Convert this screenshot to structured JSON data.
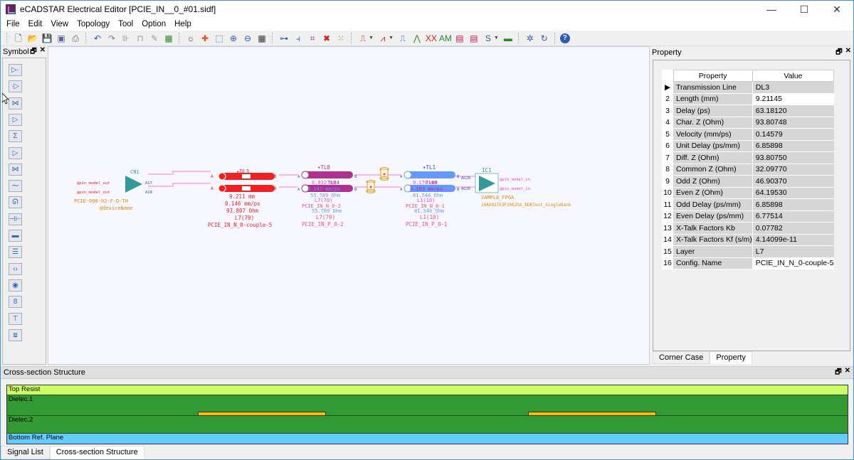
{
  "window": {
    "title": "eCADSTAR Electrical Editor [PCIE_IN__0_#01.sidf]",
    "controls": {
      "minimize": "—",
      "maximize": "☐",
      "close": "✕"
    }
  },
  "menu": [
    "File",
    "Edit",
    "View",
    "Topology",
    "Tool",
    "Option",
    "Help"
  ],
  "toolbar": {
    "groups": [
      [
        {
          "name": "new-file-icon",
          "glyph": "🗋",
          "color": "#444"
        },
        {
          "name": "open-folder-icon",
          "glyph": "📂",
          "color": "#d8a030"
        },
        {
          "name": "save-icon",
          "glyph": "💾",
          "color": "#5050a0"
        },
        {
          "name": "save-as-icon",
          "glyph": "▣",
          "color": "#6060a0"
        },
        {
          "name": "print-icon",
          "glyph": "⎙",
          "color": "#666"
        }
      ],
      [
        {
          "name": "undo-icon",
          "glyph": "↶",
          "color": "#2a5cb8"
        },
        {
          "name": "redo-icon",
          "glyph": "↷",
          "color": "#888"
        },
        {
          "name": "step-icon",
          "glyph": "⊪",
          "color": "#999"
        },
        {
          "name": "waveform-icon",
          "glyph": "⊓",
          "color": "#999"
        },
        {
          "name": "edit-component-icon",
          "glyph": "✎",
          "color": "#999"
        },
        {
          "name": "board-icon",
          "glyph": "▦",
          "color": "#2a8a2a"
        }
      ],
      [
        {
          "name": "zoom-fit-icon",
          "glyph": "☼",
          "color": "#333"
        },
        {
          "name": "zoom-all-icon",
          "glyph": "✚",
          "color": "#e05020"
        },
        {
          "name": "zoom-window-icon",
          "glyph": "⬚",
          "color": "#2a5cb8"
        },
        {
          "name": "zoom-in-icon",
          "glyph": "⊕",
          "color": "#2a5cb8"
        },
        {
          "name": "zoom-out-icon",
          "glyph": "⊖",
          "color": "#2a5cb8"
        },
        {
          "name": "grid-icon",
          "glyph": "▦",
          "color": "#333"
        }
      ],
      [
        {
          "name": "add-net-icon",
          "glyph": "⊶",
          "color": "#2a5cb8"
        },
        {
          "name": "branch-icon",
          "glyph": "⫞",
          "color": "#2a5cb8"
        },
        {
          "name": "topology-icon",
          "glyph": "⌗",
          "color": "#8a2ab8"
        },
        {
          "name": "delete-net-icon",
          "glyph": "✖",
          "color": "#d02020"
        },
        {
          "name": "matrix-icon",
          "glyph": "⁙",
          "color": "#b08020"
        }
      ],
      [
        {
          "name": "simulate-icon",
          "glyph": "⎍",
          "color": "#d02020",
          "dropdown": true
        },
        {
          "name": "analysis-icon",
          "glyph": "⩘",
          "color": "#d02020",
          "dropdown": true
        },
        {
          "name": "eye-diagram-icon",
          "glyph": "⎍",
          "color": "#2a5cb8"
        },
        {
          "name": "spectrum-icon",
          "glyph": "⋀",
          "color": "#2a8a2a"
        },
        {
          "name": "crosstalk-icon",
          "glyph": "XX",
          "color": "#d02020"
        },
        {
          "name": "ami-icon",
          "glyph": "AM",
          "color": "#2a8a2a"
        },
        {
          "name": "report-icon",
          "glyph": "▤",
          "color": "#c02050"
        },
        {
          "name": "report-export-icon",
          "glyph": "▤",
          "color": "#c02050"
        },
        {
          "name": "sparam-icon",
          "glyph": "S",
          "color": "#2a5cb8",
          "dropdown": true
        },
        {
          "name": "stackup-icon",
          "glyph": "▬",
          "color": "#2a8a2a"
        }
      ],
      [
        {
          "name": "component-icon",
          "glyph": "✲",
          "color": "#2a5cb8"
        },
        {
          "name": "history-icon",
          "glyph": "↻",
          "color": "#2a5cb8"
        }
      ],
      [
        {
          "name": "help-icon",
          "glyph": "?",
          "color": "#fff",
          "bg": "#2a5cb8"
        }
      ]
    ]
  },
  "symbol_panel": {
    "title": "Symbol",
    "items": [
      {
        "name": "driver-icon",
        "glyph": "▷·"
      },
      {
        "name": "receiver-icon",
        "glyph": "·▷"
      },
      {
        "name": "bidirectional-icon",
        "glyph": "⋈"
      },
      {
        "name": "driver-enable-icon",
        "glyph": "▷"
      },
      {
        "name": "diff-driver-icon",
        "glyph": "Σ"
      },
      {
        "name": "diff-receiver-icon",
        "glyph": "▷"
      },
      {
        "name": "diff-bidir-icon",
        "glyph": "⋈"
      },
      {
        "name": "resistor-icon",
        "glyph": "⁓"
      },
      {
        "name": "inductor-icon",
        "glyph": "ᘏ"
      },
      {
        "name": "capacitor-icon",
        "glyph": "⊣⊢"
      },
      {
        "name": "transmission-line-icon",
        "glyph": "▬"
      },
      {
        "name": "coupled-line-icon",
        "glyph": "☰"
      },
      {
        "name": "connector-icon",
        "glyph": "‹›"
      },
      {
        "name": "via-icon",
        "glyph": "◉"
      },
      {
        "name": "via-pair-icon",
        "glyph": "8"
      },
      {
        "name": "terminator-icon",
        "glyph": "⊤"
      },
      {
        "name": "package-icon",
        "glyph": "⧈"
      }
    ]
  },
  "schematic": {
    "cn1": {
      "ref": "CN1",
      "pins": [
        "A17",
        "A18"
      ],
      "pin_models": [
        "@pin_model_out",
        "@pin_model_out"
      ],
      "part": "PCIE-098-02-F-D-TH",
      "device": "@deviceName"
    },
    "dl3": {
      "ref": "▾DL3",
      "pin_a": "A",
      "pin_b": "B",
      "length": "9.211 mm",
      "velocity": "0.146 mm/ps",
      "impedance": "93.807 Ohm",
      "layer": "L7(70)",
      "config": "PCIE_IN_N_0-couple-5"
    },
    "tl8": {
      "ref": "▾TL8",
      "overlap_ref": "TL34",
      "length": "0.932 mm",
      "velocity": "0.147 mm/ps",
      "impedance": "55.789 Ohm",
      "layer": "L7(70)",
      "config": "PCIE_IN_P_0-2",
      "overlap_config": "PCIE_IN_N_0-2"
    },
    "tl1": {
      "ref": "▾TL1",
      "overlap_ref": "TL69",
      "length": "9.170 mm",
      "velocity": "0.163 mm/ps",
      "impedance": "81.546 Ohm",
      "layer": "L1(10)",
      "config": "PCIE_IN_P_0-1",
      "overlap_config": "PCIE_IN_N_0-1"
    },
    "ic1": {
      "ref": "IC1",
      "pins": [
        "AG28",
        "AG30"
      ],
      "pin_models": [
        "@pin_model_in",
        "@pin_model_in"
      ],
      "part": "SAMPLE_FPGA",
      "device": "10AX027E3F29E2SG_DDRTest_SingleRank"
    },
    "colors": {
      "net": "#ff77cc",
      "dl": "#ee2222",
      "tl8": "#b03090",
      "tl1": "#6699ff",
      "component": "#339999",
      "part_label": "#e08a00",
      "pin_model": "#ee2222",
      "pin_model_in": "#e040e0",
      "via": "#d8a030"
    }
  },
  "property_panel": {
    "title": "Property",
    "columns": [
      "Property",
      "Value"
    ],
    "rows": [
      {
        "idx": "▶",
        "key": "Transmission Line",
        "value": "DL3"
      },
      {
        "idx": "2",
        "key": "Length (mm)",
        "value": "9.21145",
        "editable": true
      },
      {
        "idx": "3",
        "key": "Delay (ps)",
        "value": "63.18120"
      },
      {
        "idx": "4",
        "key": "Char. Z (Ohm)",
        "value": "93.80748"
      },
      {
        "idx": "5",
        "key": "Velocity (mm/ps)",
        "value": "0.14579"
      },
      {
        "idx": "6",
        "key": "Unit Delay (ps/mm)",
        "value": "6.85898"
      },
      {
        "idx": "7",
        "key": "Diff. Z (Ohm)",
        "value": "93.80750"
      },
      {
        "idx": "8",
        "key": "Common Z (Ohm)",
        "value": "32.09770"
      },
      {
        "idx": "9",
        "key": "Odd Z (Ohm)",
        "value": "46.90370"
      },
      {
        "idx": "10",
        "key": "Even Z (Ohm)",
        "value": "64.19530"
      },
      {
        "idx": "11",
        "key": "Odd Delay (ps/mm)",
        "value": "6.85898"
      },
      {
        "idx": "12",
        "key": "Even Delay (ps/mm)",
        "value": "6.77514"
      },
      {
        "idx": "13",
        "key": "X-Talk Factors Kb",
        "value": "0.07782"
      },
      {
        "idx": "14",
        "key": "X-Talk Factors Kf (s/m)",
        "value": "4.14099e-11"
      },
      {
        "idx": "15",
        "key": "Layer",
        "value": "L7"
      },
      {
        "idx": "16",
        "key": "Config. Name",
        "value": "PCIE_IN_N_0-couple-5",
        "editable": true
      }
    ],
    "tabs": [
      {
        "label": "Corner Case",
        "active": false
      },
      {
        "label": "Property",
        "active": true
      }
    ]
  },
  "cross_section": {
    "title": "Cross-section Structure",
    "layers": [
      {
        "label": "Top Resist",
        "color": "#ccff66"
      },
      {
        "label": "Dielec.1",
        "color": "#339933"
      },
      {
        "label": "Dielec.2",
        "color": "#339933"
      },
      {
        "label": "Bottom Ref. Plane",
        "color": "#66ccff"
      }
    ],
    "trace_color": "#ffbb00"
  },
  "bottom_tabs": [
    {
      "label": "Signal List",
      "active": false
    },
    {
      "label": "Cross-section Structure",
      "active": true
    }
  ]
}
